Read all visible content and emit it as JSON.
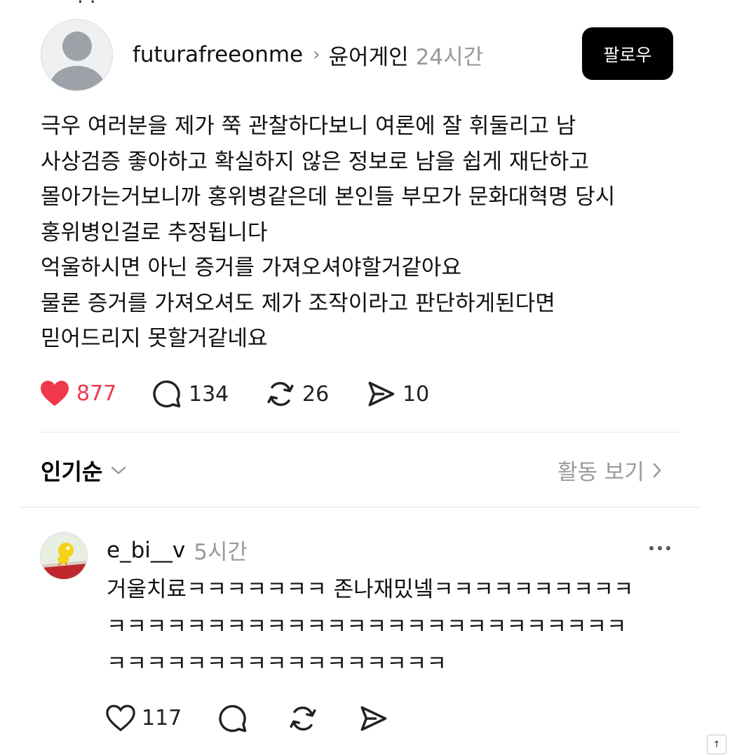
{
  "post": {
    "username": "futurafreeonme",
    "topic": "윤어게인",
    "time": "24시간",
    "follow_label": "팔로우",
    "body_lines": [
      "극우 여러분을 제가 쭉 관찰하다보니 여론에 잘 휘둘리고 남",
      "사상검증 좋아하고 확실하지 않은 정보로 남을 쉽게 재단하고",
      "몰아가는거보니까 홍위병같은데 본인들 부모가 문화대혁명 당시",
      "홍위병인걸로 추정됩니다",
      "억울하시면 아닌 증거를 가져오셔야할거같아요",
      "물론 증거를 가져오셔도 제가 조작이라고 판단하게된다면",
      "믿어드리지 못할거같네요"
    ],
    "likes": "877",
    "comments": "134",
    "reposts": "26",
    "shares": "10"
  },
  "sort": {
    "label": "인기순"
  },
  "activity": {
    "label": "활동 보기"
  },
  "comment": {
    "username": "e_bi__v",
    "time": "5시간",
    "body_lines": [
      "거울치료ㅋㅋㅋㅋㅋㅋㅋ 존나재밌넼ㅋㅋㅋㅋㅋㅋㅋㅋㅋㅋ",
      "ㅋㅋㅋㅋㅋㅋㅋㅋㅋㅋㅋㅋㅋㅋㅋㅋㅋㅋㅋㅋㅋㅋㅋㅋㅋㅋ",
      "ㅋㅋㅋㅋㅋㅋㅋㅋㅋㅋㅋㅋㅋㅋㅋㅋㅋ"
    ],
    "likes": "117"
  },
  "scroll_top": {
    "label": "↑"
  },
  "colors": {
    "like_red": "#f0384b",
    "muted": "#999999",
    "follow_bg": "#000000"
  },
  "icons": [
    "heart-icon",
    "comment-icon",
    "repost-icon",
    "share-icon",
    "chevron-down-icon",
    "chevron-right-icon",
    "more-icon"
  ]
}
